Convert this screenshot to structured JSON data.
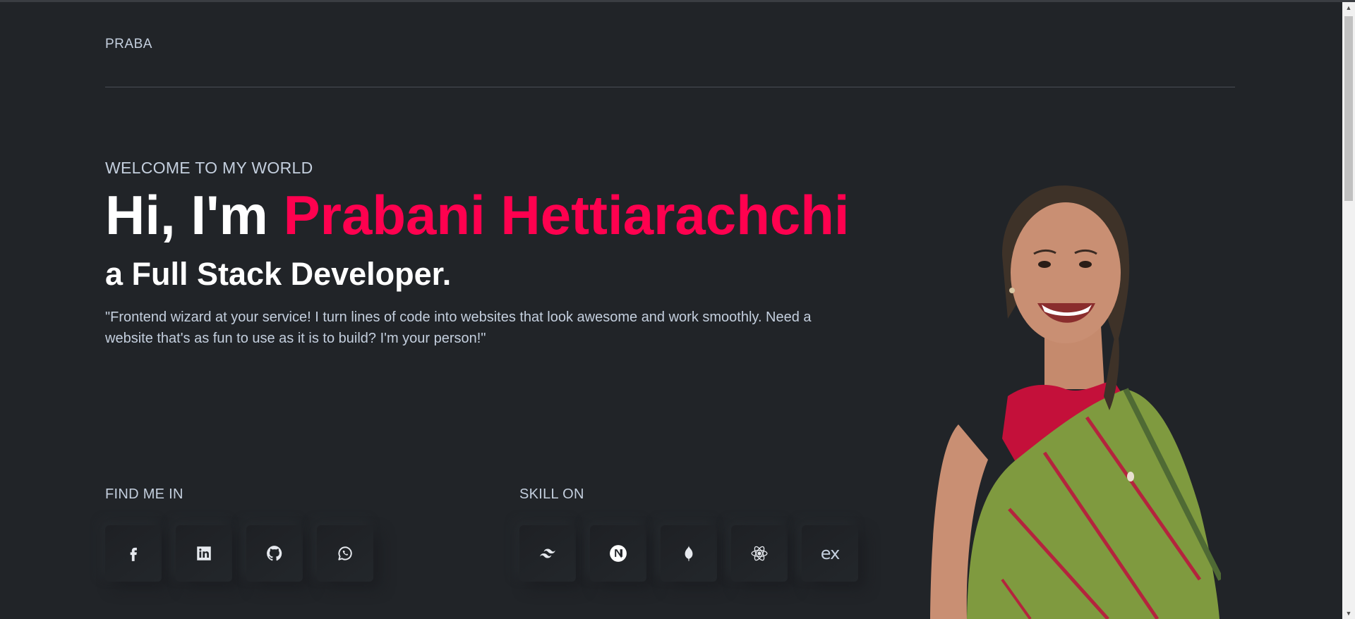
{
  "header": {
    "logo": "PRABA"
  },
  "hero": {
    "welcome": "WELCOME TO MY WORLD",
    "greeting": "Hi, I'm ",
    "name": "Prabani Hettiarachchi",
    "role": "a Full Stack Developer.",
    "description": "\"Frontend wizard at your service! I turn lines of code into websites that look awesome and work smoothly. Need a website that's as fun to use as it is to build? I'm your person!\""
  },
  "find_me": {
    "title": "FIND ME IN",
    "icons": [
      "facebook-icon",
      "linkedin-icon",
      "github-icon",
      "whatsapp-icon"
    ]
  },
  "skills": {
    "title": "SKILL ON",
    "icons": [
      "tailwind-icon",
      "nextjs-icon",
      "mongodb-icon",
      "react-icon",
      "express-icon"
    ],
    "express_label": "ex"
  },
  "colors": {
    "background": "#212428",
    "accent": "#ff014f",
    "text": "#c4cfde",
    "heading": "#ffffff"
  }
}
